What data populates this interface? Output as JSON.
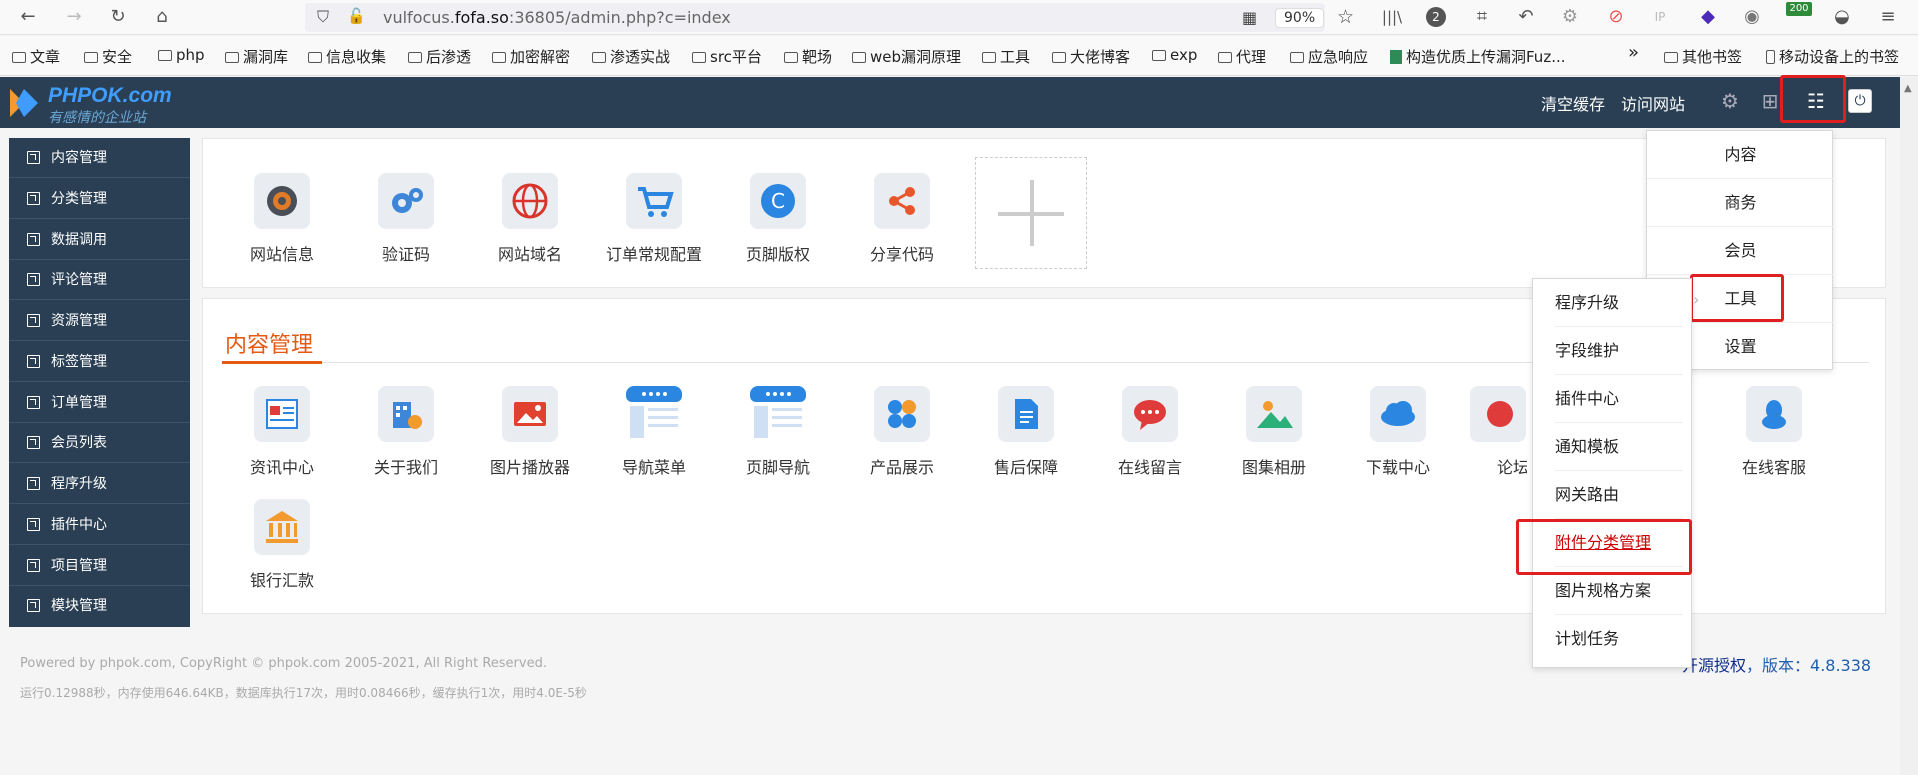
{
  "browser": {
    "url_prefix": "vulfocus.",
    "url_domain": "fofa.so",
    "url_suffix": ":36805/admin.php?c=index",
    "zoom": "90%",
    "badge_count": "2",
    "badge_200": "200",
    "ip_label": "IP"
  },
  "bookmarks": {
    "items": [
      "文章",
      "安全",
      "php",
      "漏洞库",
      "信息收集",
      "后渗透",
      "加密解密",
      "渗透实战",
      "src平台",
      "靶场",
      "web漏洞原理",
      "工具",
      "大佬博客",
      "exp",
      "代理",
      "应急响应",
      "构造优质上传漏洞Fuz..."
    ],
    "more": "»",
    "other": "其他书签",
    "mobile": "移动设备上的书签"
  },
  "header": {
    "logo_text": "PHPOK.com",
    "logo_slogan": "有感情的企业站",
    "clear_cache": "清空缓存",
    "visit_site": "访问网站"
  },
  "sidebar": {
    "items": [
      "内容管理",
      "分类管理",
      "数据调用",
      "评论管理",
      "资源管理",
      "标签管理",
      "订单管理",
      "会员列表",
      "程序升级",
      "插件中心",
      "项目管理",
      "模块管理"
    ]
  },
  "quick": {
    "items": [
      "网站信息",
      "验证码",
      "网站域名",
      "订单常规配置",
      "页脚版权",
      "分享代码"
    ]
  },
  "content_section": {
    "title": "内容管理",
    "items": [
      "资讯中心",
      "关于我们",
      "图片播放器",
      "导航菜单",
      "页脚导航",
      "产品展示",
      "售后保障",
      "在线留言",
      "图集相册",
      "下载中心",
      "论坛B",
      "在线客服",
      "银行汇款"
    ]
  },
  "footer": {
    "copyright": "Powered by phpok.com, CopyRight © phpok.com 2005-2021, All Right Reserved.",
    "stats": "运行0.12988秒，内存使用646.64KB，数据库执行17次，用时0.08466秒，缓存执行1次，用时4.0E-5秒",
    "license": "开源授权",
    "version": "，版本：4.8.338"
  },
  "main_menu": {
    "items": [
      "内容",
      "商务",
      "会员",
      "工具",
      "设置"
    ]
  },
  "tools_submenu": {
    "items": [
      "程序升级",
      "字段维护",
      "插件中心",
      "通知模板",
      "网关路由",
      "附件分类管理",
      "图片规格方案",
      "计划任务"
    ]
  },
  "colors": {
    "header_bg": "#2a3f54",
    "accent_orange": "#e45a12",
    "highlight_red": "#e02020",
    "link_blue": "#1f5fb0"
  }
}
